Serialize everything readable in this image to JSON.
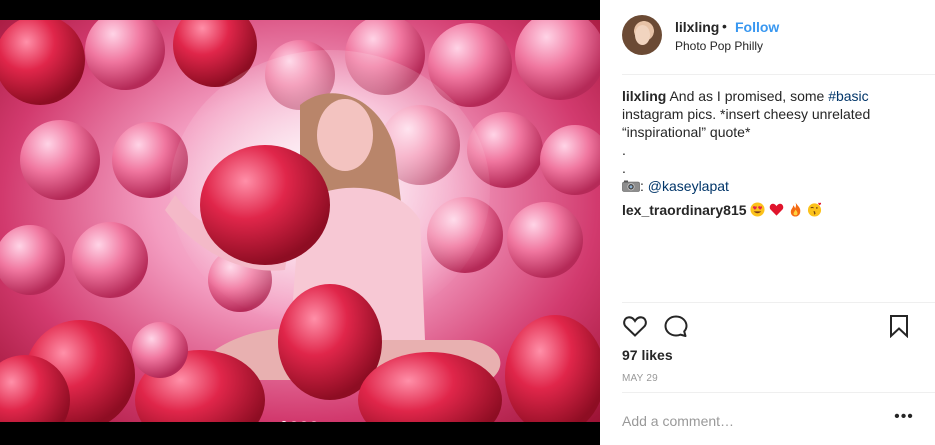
{
  "post": {
    "dots_count": 4,
    "active_dot": 0
  },
  "header": {
    "username": "lilxling",
    "separator": "•",
    "follow_label": "Follow",
    "location": "Photo Pop Philly"
  },
  "caption": {
    "username": "lilxling",
    "text_before_tag": " And as I promised, some ",
    "hashtag": "#basic",
    "text_after_tag": " instagram pics. *insert cheesy unrelated “inspirational” quote*",
    "dot_line_1": ".",
    "dot_line_2": ".",
    "credit_prefix": ": ",
    "credit_mention": "@kaseylapat",
    "camera_icon": "camera-icon"
  },
  "comment": {
    "username": "lex_traordinary815",
    "emojis": [
      "heart-eyes-emoji",
      "red-heart-emoji",
      "fire-emoji",
      "kiss-emoji"
    ]
  },
  "actions": {
    "like_icon": "heart-icon",
    "comment_icon": "comment-icon",
    "save_icon": "bookmark-icon"
  },
  "stats": {
    "likes": "97 likes",
    "date": "MAY 29"
  },
  "add_comment": {
    "placeholder": "Add a comment…",
    "more_label": "•••"
  },
  "colors": {
    "link_blue": "#3897f0",
    "hashtag": "#003569",
    "balloon_red": "#d9142c"
  }
}
